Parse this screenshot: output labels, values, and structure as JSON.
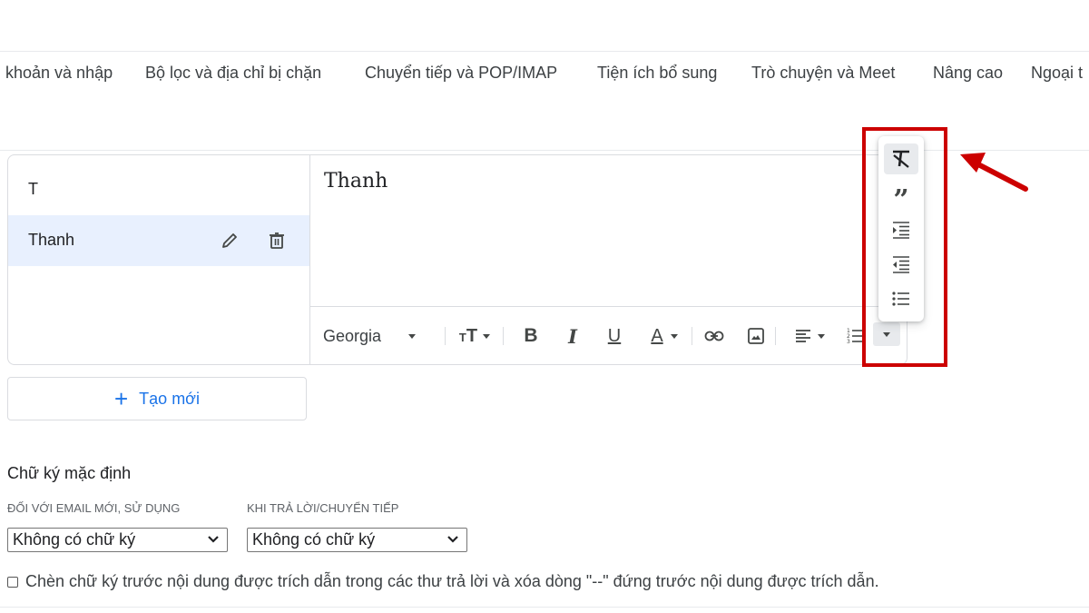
{
  "tabs": [
    "khoản và nhập",
    "Bộ lọc và địa chỉ bị chặn",
    "Chuyển tiếp và POP/IMAP",
    "Tiện ích bổ sung",
    "Trò chuyện và Meet",
    "Nâng cao",
    "Ngoại t"
  ],
  "signatures": [
    {
      "name": "T",
      "selected": false
    },
    {
      "name": "Thanh",
      "selected": true
    }
  ],
  "editor": {
    "content": "Thanh",
    "font": "Georgia"
  },
  "toolbar_icons": [
    "text-size-icon",
    "bold-icon",
    "italic-icon",
    "underline-icon",
    "text-color-icon",
    "link-icon",
    "image-icon",
    "align-icon",
    "numbered-list-icon",
    "more-formatting-icon"
  ],
  "more_menu_icons": [
    "remove-formatting-icon",
    "quote-icon",
    "indent-more-icon",
    "indent-less-icon",
    "bulleted-list-icon"
  ],
  "create_new": "Tạo mới",
  "default_signature": {
    "title": "Chữ ký mặc định",
    "new_email_label": "ĐỐI VỚI EMAIL MỚI, SỬ DỤNG",
    "new_email_value": "Không có chữ ký",
    "reply_label": "KHI TRẢ LỜI/CHUYỂN TIẾP",
    "reply_value": "Không có chữ ký"
  },
  "insert_before_quote": "Chèn chữ ký trước nội dung được trích dẫn trong các thư trả lời và xóa dòng \"--\" đứng trước nội dung được trích dẫn.",
  "colors": {
    "highlight": "#cc0000",
    "link": "#1a73e8",
    "selected_bg": "#e8f0fe"
  }
}
